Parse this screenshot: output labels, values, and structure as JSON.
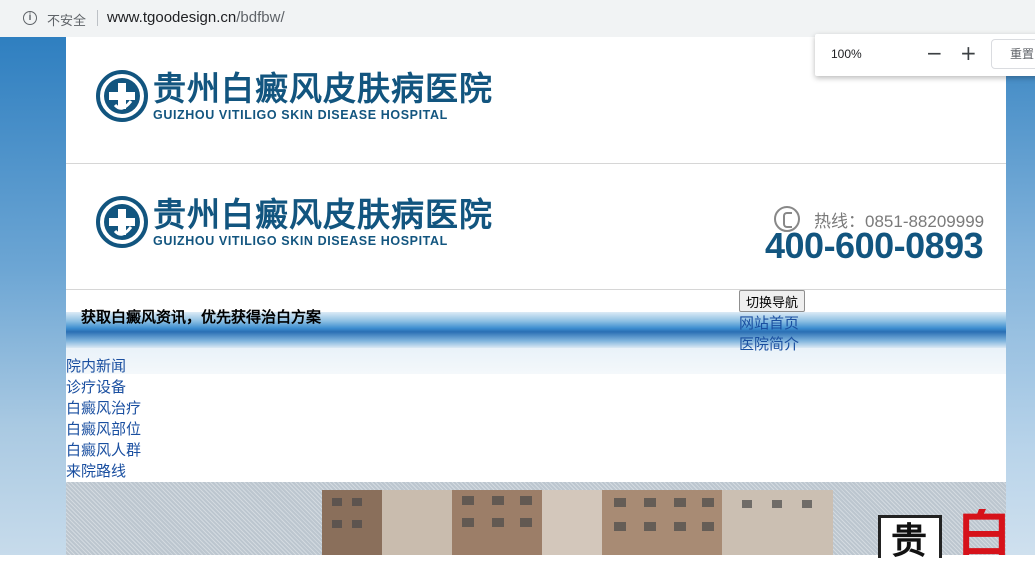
{
  "browser": {
    "security_label": "不安全",
    "url_domain": "www.tgoodesign.cn",
    "url_path": "/bdfbw/",
    "zoom_level": "100%",
    "zoom_minus": "−",
    "zoom_plus": "+",
    "zoom_reset": "重置"
  },
  "header": {
    "logo_cn": "贵州白癜风皮肤病医院",
    "logo_en": "GUIZHOU VITILIGO SKIN DISEASE HOSPITAL",
    "hotline": "热线：0851-88209999",
    "phone_big": "400-600-0893",
    "tagline": "获取白癜风资讯，优先获得治白方案"
  },
  "nav": {
    "switch_button": "切换导航",
    "items": [
      "网站首页",
      "医院简介",
      "院内新闻",
      "诊疗设备",
      "白癜风治疗",
      "白癜风部位",
      "白癜风人群",
      "来院路线"
    ]
  },
  "banner": {
    "sign_char": "贵",
    "red_char": "白"
  },
  "colors": {
    "brand": "#12557f",
    "link": "#1a4fa0",
    "accent_red": "#d6121a"
  }
}
